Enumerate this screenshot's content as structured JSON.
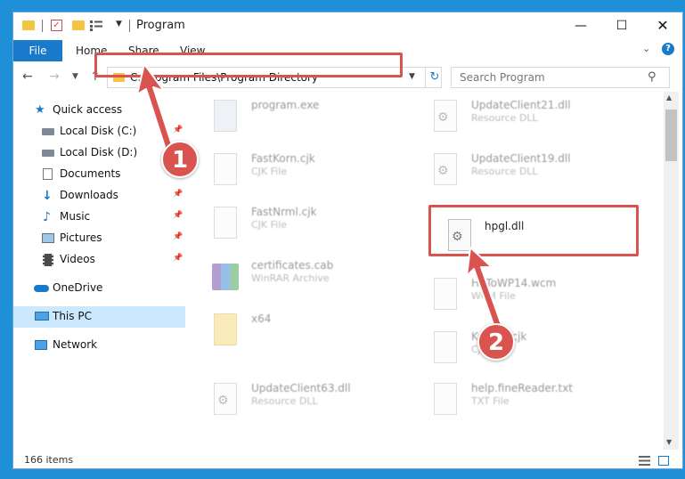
{
  "window": {
    "title": "Program",
    "controls": {
      "minimize": "—",
      "maximize": "☐",
      "close": "✕"
    }
  },
  "ribbon": {
    "tabs": [
      "File",
      "Home",
      "Share",
      "View"
    ]
  },
  "address": {
    "path": "C:\\Program Files\\Program Directory"
  },
  "search": {
    "placeholder": "Search Program"
  },
  "sidebar": {
    "items": [
      {
        "label": "Quick access",
        "icon": "star-icon"
      },
      {
        "label": "Local Disk (C:)",
        "icon": "drive-icon"
      },
      {
        "label": "Local Disk (D:)",
        "icon": "drive-icon"
      },
      {
        "label": "Documents",
        "icon": "documents-icon"
      },
      {
        "label": "Downloads",
        "icon": "download-icon"
      },
      {
        "label": "Music",
        "icon": "music-icon"
      },
      {
        "label": "Pictures",
        "icon": "pictures-icon"
      },
      {
        "label": "Videos",
        "icon": "videos-icon"
      },
      {
        "label": "OneDrive",
        "icon": "cloud-icon"
      },
      {
        "label": "This PC",
        "icon": "computer-icon"
      },
      {
        "label": "Network",
        "icon": "network-icon"
      }
    ]
  },
  "files": [
    {
      "name": "program.exe",
      "type": ""
    },
    {
      "name": "UpdateClient21.dll",
      "type": "Resource DLL"
    },
    {
      "name": "FastKorn.cjk",
      "type": "CJK File"
    },
    {
      "name": "UpdateClient19.dll",
      "type": "Resource DLL"
    },
    {
      "name": "FastNrml.cjk",
      "type": "CJK File"
    },
    {
      "name": "hpgl.dll",
      "type": ""
    },
    {
      "name": "certificates.cab",
      "type": "WinRAR Archive"
    },
    {
      "name": "HoToWP14.wcm",
      "type": "WCM File"
    },
    {
      "name": "x64",
      "type": ""
    },
    {
      "name": "Korean.cjk",
      "type": "CJK File"
    },
    {
      "name": "UpdateClient63.dll",
      "type": "Resource DLL"
    },
    {
      "name": "help.fineReader.txt",
      "type": "TXT File"
    }
  ],
  "status": {
    "count": "166 items"
  },
  "callouts": [
    "1",
    "2"
  ],
  "colors": {
    "accent": "#1979ca",
    "highlight": "#d9534f",
    "selected": "#cce8ff"
  }
}
